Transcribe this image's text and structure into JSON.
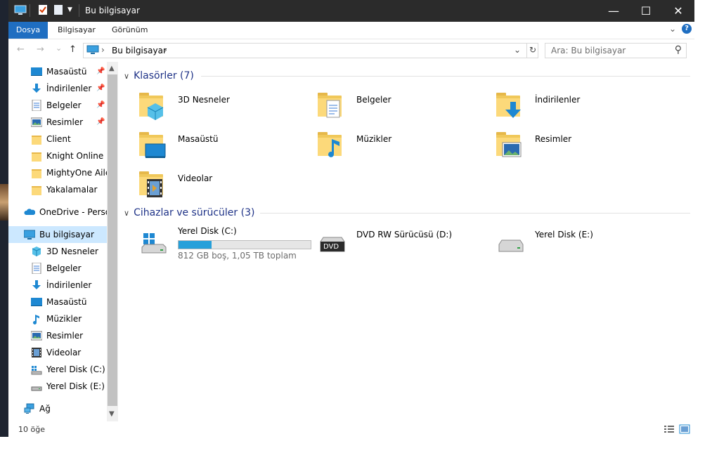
{
  "titlebar": {
    "title": "Bu bilgisayar",
    "minimize_glyph": "—",
    "maximize_glyph": "☐",
    "close_glyph": "✕"
  },
  "ribbon": {
    "tabs": [
      {
        "label": "Dosya",
        "active": true
      },
      {
        "label": "Bilgisayar"
      },
      {
        "label": "Görünüm"
      }
    ],
    "expand_glyph": "⌄",
    "help_glyph": "?"
  },
  "nav": {
    "back_glyph": "←",
    "forward_glyph": "→",
    "recent_glyph": "⌄",
    "up_glyph": "↑",
    "breadcrumb": "Bu bilgisayar",
    "breadcrumb_sep": "›",
    "dropdown_glyph": "⌄",
    "refresh_glyph": "↻",
    "search_placeholder": "Ara: Bu bilgisayar",
    "search_glyph": "⚲"
  },
  "sidebar": {
    "quick_access": [
      {
        "label": "Masaüstü",
        "icon": "desktop-icon",
        "pinned": true
      },
      {
        "label": "İndirilenler",
        "icon": "download-icon",
        "pinned": true
      },
      {
        "label": "Belgeler",
        "icon": "document-icon",
        "pinned": true
      },
      {
        "label": "Resimler",
        "icon": "pictures-icon",
        "pinned": true
      },
      {
        "label": "Client",
        "icon": "folder-icon"
      },
      {
        "label": "Knight Online",
        "icon": "folder-icon"
      },
      {
        "label": "MightyOne Ailes",
        "icon": "folder-icon"
      },
      {
        "label": "Yakalamalar",
        "icon": "folder-icon"
      }
    ],
    "onedrive": "OneDrive - Persor",
    "this_pc": "Bu bilgisayar",
    "this_pc_items": [
      {
        "label": "3D Nesneler",
        "icon": "cube-3d-icon"
      },
      {
        "label": "Belgeler",
        "icon": "document-icon"
      },
      {
        "label": "İndirilenler",
        "icon": "download-icon"
      },
      {
        "label": "Masaüstü",
        "icon": "desktop-icon"
      },
      {
        "label": "Müzikler",
        "icon": "music-icon"
      },
      {
        "label": "Resimler",
        "icon": "pictures-icon"
      },
      {
        "label": "Videolar",
        "icon": "video-icon"
      },
      {
        "label": "Yerel Disk (C:)",
        "icon": "windows-drive-icon"
      },
      {
        "label": "Yerel Disk (E:)",
        "icon": "drive-icon"
      }
    ],
    "network": "Ağ",
    "pin_glyph": "📌"
  },
  "content": {
    "folders_header": "Klasörler (7)",
    "folders": [
      {
        "label": "3D Nesneler",
        "icon": "cube-3d-icon"
      },
      {
        "label": "Belgeler",
        "icon": "document-icon"
      },
      {
        "label": "İndirilenler",
        "icon": "download-icon"
      },
      {
        "label": "Masaüstü",
        "icon": "desktop-icon"
      },
      {
        "label": "Müzikler",
        "icon": "music-icon"
      },
      {
        "label": "Resimler",
        "icon": "pictures-icon"
      },
      {
        "label": "Videolar",
        "icon": "video-icon"
      }
    ],
    "devices_header": "Cihazlar ve sürücüler (3)",
    "devices": [
      {
        "label": "Yerel Disk (C:)",
        "icon": "windows-drive-icon",
        "space_text": "812 GB boş, 1,05 TB toplam",
        "used_fraction": 0.25
      },
      {
        "label": "DVD RW Sürücüsü (D:)",
        "icon": "dvd-drive-icon",
        "badge": "DVD"
      },
      {
        "label": "Yerel Disk (E:)",
        "icon": "drive-icon"
      }
    ]
  },
  "status": {
    "count": "10 öğe"
  },
  "colors": {
    "titlebar": "#2b2b2b",
    "file_tab": "#1f6ec1",
    "selection": "#cce8ff",
    "group_header": "#1e3287",
    "drive_bar": "#26a0da"
  }
}
